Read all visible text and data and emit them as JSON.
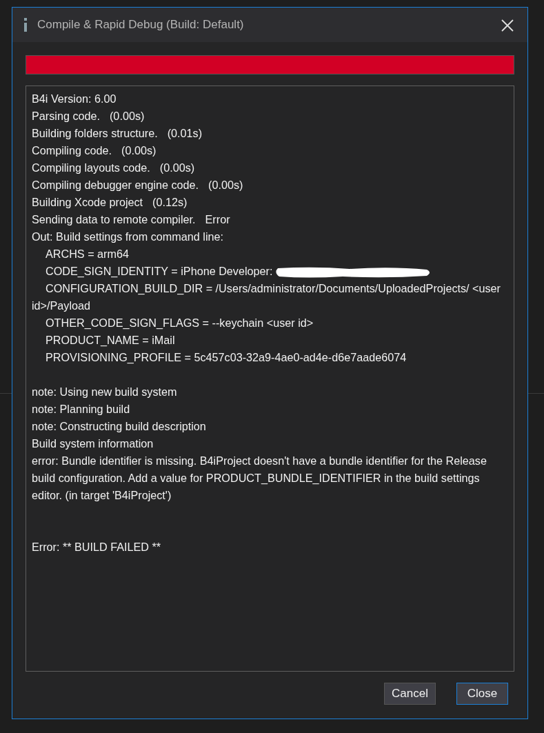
{
  "window": {
    "title": "Compile & Rapid Debug (Build: Default)"
  },
  "progress": {
    "level": 1
  },
  "log": [
    {
      "kind": "line",
      "text": "B4i Version: 6.00",
      "indent": false
    },
    {
      "kind": "line",
      "text": "Parsing code.",
      "result": "(0.00s)",
      "indent": false
    },
    {
      "kind": "line",
      "text": "Building folders structure.",
      "result": "(0.01s)",
      "indent": false
    },
    {
      "kind": "line",
      "text": "Compiling code.",
      "result": "(0.00s)",
      "indent": false
    },
    {
      "kind": "line",
      "text": "Compiling layouts code.",
      "result": "(0.00s)",
      "indent": false
    },
    {
      "kind": "line",
      "text": "Compiling debugger engine code.",
      "result": "(0.00s)",
      "indent": false
    },
    {
      "kind": "line",
      "text": "Building Xcode project",
      "result": "(0.12s)",
      "indent": false
    },
    {
      "kind": "line",
      "text": "Sending data to remote compiler.",
      "result": "Error",
      "indent": false
    },
    {
      "kind": "line",
      "text": "Out: Build settings from command line:",
      "indent": false
    },
    {
      "kind": "line",
      "text": "ARCHS = arm64",
      "indent": true
    },
    {
      "kind": "redacted",
      "text": "CODE_SIGN_IDENTITY = iPhone Developer:",
      "indent": true
    },
    {
      "kind": "line",
      "text": "CONFIGURATION_BUILD_DIR = /Users/administrator/Documents/UploadedProjects/ <user id>/Payload",
      "indent": true
    },
    {
      "kind": "line",
      "text": "OTHER_CODE_SIGN_FLAGS = --keychain <user id>",
      "indent": true
    },
    {
      "kind": "line",
      "text": "PRODUCT_NAME = iMail",
      "indent": true
    },
    {
      "kind": "line",
      "text": "PROVISIONING_PROFILE = 5c457c03-32a9-4ae0-ad4e-d6e7aade6074",
      "indent": true
    },
    {
      "kind": "blank"
    },
    {
      "kind": "line",
      "text": "note: Using new build system",
      "indent": false
    },
    {
      "kind": "line",
      "text": "note: Planning build",
      "indent": false
    },
    {
      "kind": "line",
      "text": "note: Constructing build description",
      "indent": false
    },
    {
      "kind": "line",
      "text": "Build system information",
      "indent": false
    },
    {
      "kind": "line",
      "text": "error: Bundle identifier is missing. B4iProject doesn't have a bundle identifier for the Release build configuration. Add a value for PRODUCT_BUNDLE_IDENTIFIER in the build settings editor. (in target 'B4iProject')",
      "indent": false
    },
    {
      "kind": "blank"
    },
    {
      "kind": "blank"
    },
    {
      "kind": "line",
      "text": "Error: ** BUILD FAILED **",
      "indent": false
    }
  ],
  "buttons": [
    {
      "label": "Cancel",
      "default": false
    },
    {
      "label": "Close",
      "default": true
    }
  ]
}
